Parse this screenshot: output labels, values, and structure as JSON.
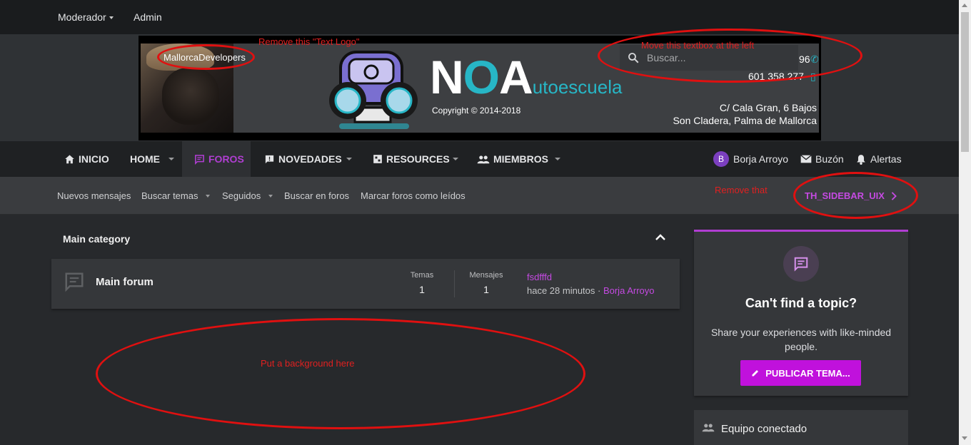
{
  "topbar": {
    "moderator": "Moderador",
    "admin": "Admin"
  },
  "banner": {
    "text_logo": "MallorcaDevelopers",
    "brand_noa": "NOA",
    "brand_suffix": "utoescuela",
    "copyright": "Copyright © 2014-2018",
    "phone1": "96",
    "phone2": "601 358 277",
    "address_line1": "C/ Cala Gran, 6 Bajos",
    "address_line2": "Son Cladera, Palma de Mallorca"
  },
  "search": {
    "placeholder": "Buscar..."
  },
  "nav": {
    "inicio": "INICIO",
    "home": "HOME",
    "foros": "FOROS",
    "novedades": "NOVEDADES",
    "resources": "RESOURCES",
    "miembros": "MIEMBROS",
    "user": "Borja Arroyo",
    "user_initial": "B",
    "inbox": "Buzón",
    "alerts": "Alertas"
  },
  "subnav": {
    "new_posts": "Nuevos mensajes",
    "search_threads": "Buscar temas",
    "watched": "Seguidos",
    "search_forums": "Buscar en foros",
    "mark_read": "Marcar foros como leídos",
    "sidebar_link": "TH_SIDEBAR_UIX"
  },
  "category": {
    "title": "Main category",
    "forum": {
      "title": "Main forum",
      "threads_label": "Temas",
      "threads": "1",
      "messages_label": "Mensajes",
      "messages": "1",
      "latest_title": "fsdfffd",
      "latest_time": "hace 28 minutos · ",
      "latest_user": "Borja Arroyo"
    }
  },
  "sidebar": {
    "cta_title": "Can't find a topic?",
    "cta_text": "Share your experiences with like-minded people.",
    "cta_button": "PUBLICAR TEMA...",
    "staff_title": "Equipo conectado"
  },
  "annotations": {
    "remove_logo": "Remove this \"Text Logo\"",
    "move_textbox": "Move this textbox at the left",
    "remove_that": "Remove that",
    "background": "Put a background here"
  },
  "colors": {
    "accent": "#c011dc",
    "link": "#c54ae2",
    "brand_teal": "#27b6c6",
    "annotation": "#e01010"
  }
}
